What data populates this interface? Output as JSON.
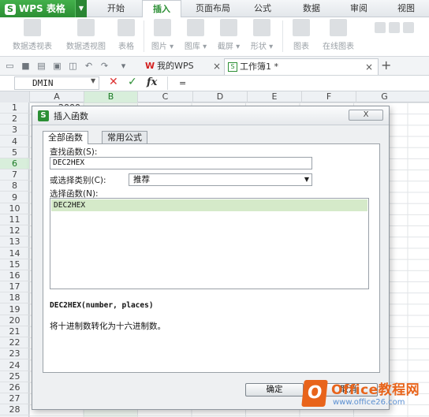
{
  "app": {
    "name": "WPS 表格",
    "logo_letter": "S"
  },
  "menu_tabs": [
    {
      "label": "开始",
      "active": false
    },
    {
      "label": "插入",
      "active": true
    },
    {
      "label": "页面布局",
      "active": false
    },
    {
      "label": "公式",
      "active": false
    },
    {
      "label": "数据",
      "active": false
    },
    {
      "label": "审阅",
      "active": false
    },
    {
      "label": "视图",
      "active": false
    }
  ],
  "ribbon": {
    "items": [
      {
        "label": "数据透视表",
        "icon": "pivot-table-icon"
      },
      {
        "label": "数据透视图",
        "icon": "pivot-chart-icon"
      },
      {
        "label": "表格",
        "icon": "table-icon"
      },
      {
        "label": "图片 ▾",
        "icon": "picture-icon"
      },
      {
        "label": "图库 ▾",
        "icon": "gallery-icon"
      },
      {
        "label": "截屏 ▾",
        "icon": "screenshot-icon"
      },
      {
        "label": "形状 ▾",
        "icon": "shapes-icon"
      },
      {
        "label": "图表",
        "icon": "chart-icon"
      },
      {
        "label": "在线图表",
        "icon": "online-chart-icon"
      }
    ]
  },
  "quick_access": {
    "doc_tabs": [
      {
        "label": "我的WPS",
        "icon": "wps-logo-icon"
      },
      {
        "label": "工作簿1 *",
        "icon": "workbook-icon"
      }
    ],
    "close_glyph": "×",
    "new_tab_glyph": "+"
  },
  "formula_bar": {
    "name_box": "DMIN",
    "cancel_glyph": "✕",
    "confirm_glyph": "✓",
    "fx_label": "fx",
    "formula": "="
  },
  "sheet": {
    "columns": [
      "A",
      "B",
      "C",
      "D",
      "E",
      "F",
      "G"
    ],
    "selected_column": "B",
    "rows": [
      "1",
      "2",
      "3",
      "4",
      "5",
      "6",
      "7",
      "8",
      "9",
      "10",
      "11",
      "12",
      "13",
      "14",
      "15",
      "16",
      "17",
      "18",
      "19",
      "20",
      "21",
      "22",
      "23",
      "24",
      "25",
      "26",
      "27",
      "28"
    ],
    "selected_row": "6",
    "cell_a1": "2000"
  },
  "dialog": {
    "title": "插入函数",
    "close_glyph": "X",
    "tabs": [
      {
        "label": "全部函数",
        "active": true
      },
      {
        "label": "常用公式",
        "active": false
      }
    ],
    "search_label": "查找函数(S):",
    "search_value": "DEC2HEX",
    "category_label": "或选择类别(C):",
    "category_value": "推荐",
    "function_label": "选择函数(N):",
    "functions": [
      "DEC2HEX"
    ],
    "signature": "DEC2HEX(number, places)",
    "description": "将十进制数转化为十六进制数。",
    "ok_label": "确定",
    "cancel_label": "取消"
  },
  "watermark": {
    "brand": "Office教程网",
    "url": "www.office26.com"
  }
}
